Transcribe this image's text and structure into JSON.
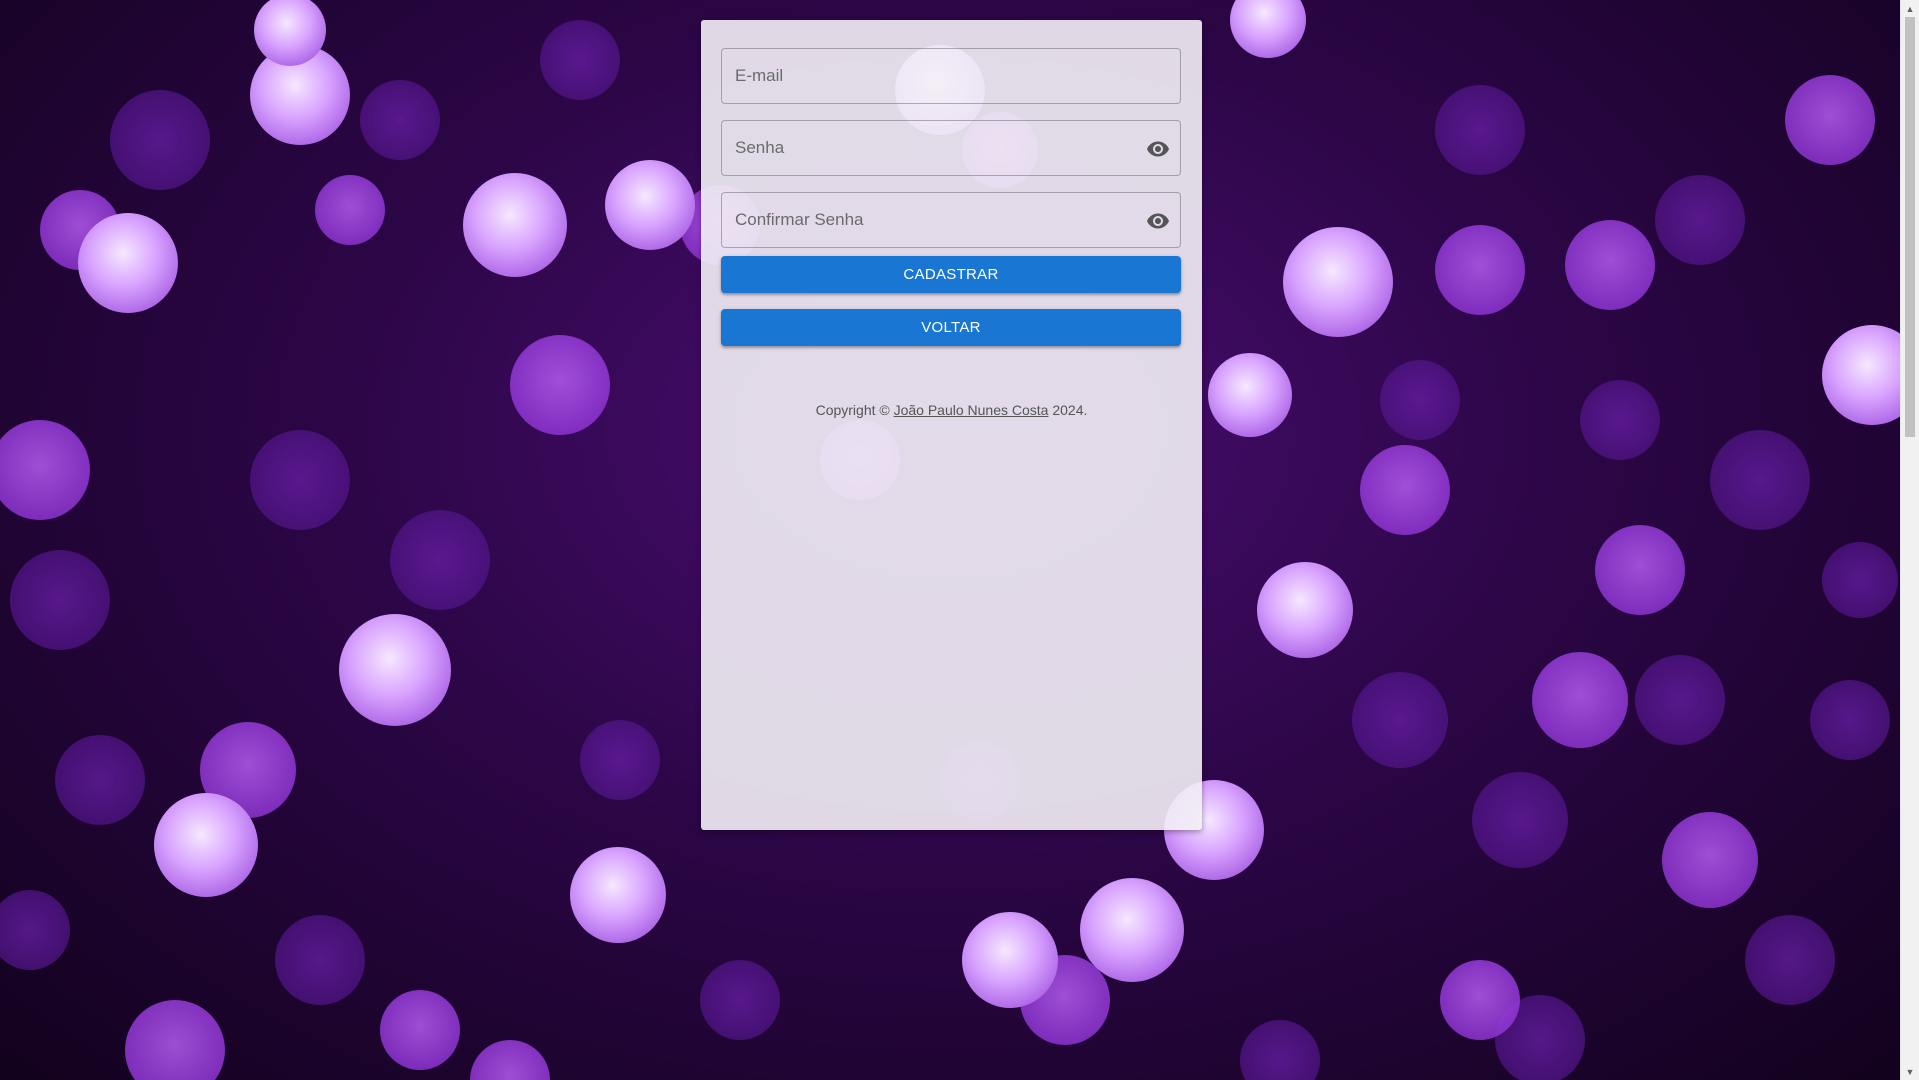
{
  "background": {
    "theme": "purple-bokeh",
    "colors": [
      "#12021d",
      "#4a0d72",
      "#8a2be2",
      "#d8a6ff"
    ]
  },
  "form": {
    "email": {
      "placeholder": "E-mail",
      "value": ""
    },
    "password": {
      "placeholder": "Senha",
      "value": "",
      "toggle_icon": "eye-icon"
    },
    "confirm_password": {
      "placeholder": "Confirmar Senha",
      "value": "",
      "toggle_icon": "eye-icon"
    },
    "register_label": "CADASTRAR",
    "back_label": "VOLTAR",
    "button_color": "#1976d2"
  },
  "footer": {
    "prefix": "Copyright ©",
    "author": "João Paulo Nunes Costa",
    "year": "2024."
  }
}
